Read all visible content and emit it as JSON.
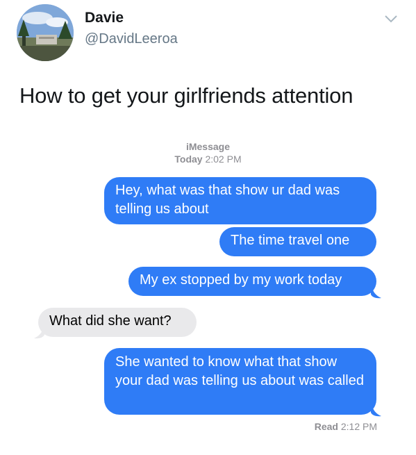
{
  "tweet": {
    "display_name": "Davie",
    "handle": "@DavidLeeroa",
    "text": "How to get your girlfriends attention",
    "menu_icon": "chevron-down-icon"
  },
  "imessage": {
    "service_label": "iMessage",
    "day_label": "Today",
    "time_label": "2:02 PM",
    "messages": [
      {
        "sender": "me",
        "text": "Hey, what was that show ur dad was telling us about"
      },
      {
        "sender": "me",
        "text": "The time travel one"
      },
      {
        "sender": "me",
        "text": "My ex stopped by my work today"
      },
      {
        "sender": "them",
        "text": "What did she want?"
      },
      {
        "sender": "me",
        "text": "She wanted to know what that show your dad was telling us about was called"
      }
    ],
    "read_label": "Read",
    "read_time": "2:12 PM"
  },
  "colors": {
    "sent_bubble": "#2f7cf6",
    "received_bubble": "#e9e9eb",
    "meta_gray": "#8e8e93"
  }
}
